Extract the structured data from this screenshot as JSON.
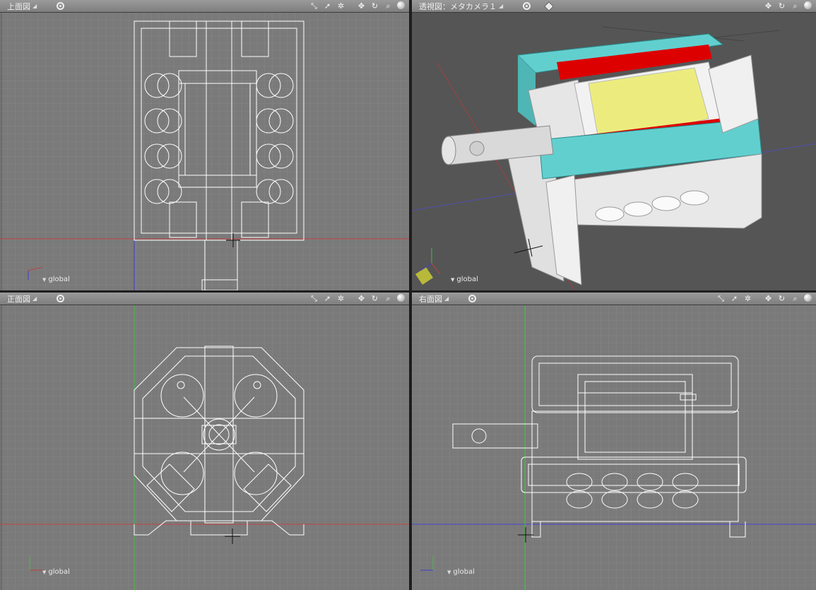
{
  "viewports": {
    "top": {
      "title": "上面図",
      "coord_label": "global",
      "axis_labels": [
        "Y",
        "X",
        "Z"
      ]
    },
    "persp": {
      "title": "透視図：メタカメラ１",
      "coord_label": "global",
      "axis_labels": [
        "Y"
      ]
    },
    "front": {
      "title": "正面図",
      "coord_label": "global",
      "axis_labels": [
        "Y",
        "X"
      ]
    },
    "right": {
      "title": "右面図",
      "coord_label": "global",
      "axis_labels": [
        "Y",
        "Z"
      ]
    }
  },
  "toolbar_icons": [
    "zoom-fit-icon",
    "select-icon",
    "settings-gear-icon",
    "pan-icon",
    "rotate-icon",
    "magnify-icon",
    "shading-sphere-icon"
  ],
  "colors": {
    "wireframe": "#ffffff",
    "grid_bg": "#7a7a7a",
    "persp_bg": "#555555",
    "axis_x": "#c04040",
    "axis_y": "#40c040",
    "axis_z": "#4040d0",
    "model_cyan": "#62cfcf",
    "model_red": "#dd0000",
    "model_yellow": "#ecec7e",
    "model_white": "#e6e6e6"
  }
}
